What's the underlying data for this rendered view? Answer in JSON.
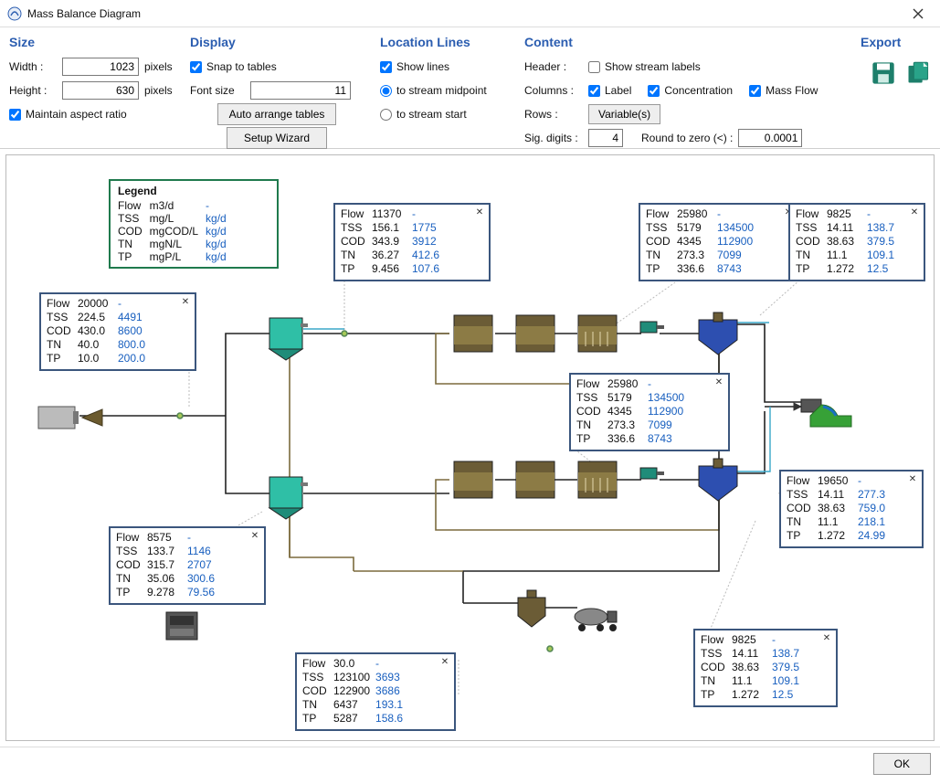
{
  "window": {
    "title": "Mass Balance Diagram"
  },
  "size": {
    "heading": "Size",
    "width_label": "Width :",
    "width_value": "1023",
    "height_label": "Height :",
    "height_value": "630",
    "units": "pixels",
    "aspect_label": "Maintain aspect ratio"
  },
  "display": {
    "heading": "Display",
    "snap_label": "Snap to tables",
    "font_label": "Font size",
    "font_value": "11",
    "auto_btn": "Auto arrange tables",
    "wizard_btn": "Setup Wizard"
  },
  "loc": {
    "heading": "Location Lines",
    "show_label": "Show lines",
    "mid_label": "to stream midpoint",
    "start_label": "to stream start"
  },
  "content": {
    "heading": "Content",
    "header_label": "Header :",
    "stream_labels": "Show stream labels",
    "columns_label": "Columns :",
    "label_chk": "Label",
    "conc_chk": "Concentration",
    "mf_chk": "Mass Flow",
    "rows_label": "Rows :",
    "var_btn": "Variable(s)",
    "sig_label": "Sig. digits :",
    "sig_value": "4",
    "round_label": "Round to zero (<) :",
    "round_value": "0.0001"
  },
  "export": {
    "heading": "Export"
  },
  "footer": {
    "ok": "OK"
  },
  "legend": {
    "title": "Legend",
    "rows": [
      {
        "label": "Flow",
        "conc_unit": "m3/d",
        "mf_unit": "-"
      },
      {
        "label": "TSS",
        "conc_unit": "mg/L",
        "mf_unit": "kg/d"
      },
      {
        "label": "COD",
        "conc_unit": "mgCOD/L",
        "mf_unit": "kg/d"
      },
      {
        "label": "TN",
        "conc_unit": "mgN/L",
        "mf_unit": "kg/d"
      },
      {
        "label": "TP",
        "conc_unit": "mgP/L",
        "mf_unit": "kg/d"
      }
    ]
  },
  "tables": {
    "t_influent": {
      "rows": [
        {
          "l": "Flow",
          "v": "20000",
          "m": "-"
        },
        {
          "l": "TSS",
          "v": "224.5",
          "m": "4491"
        },
        {
          "l": "COD",
          "v": "430.0",
          "m": "8600"
        },
        {
          "l": "TN",
          "v": "40.0",
          "m": "800.0"
        },
        {
          "l": "TP",
          "v": "10.0",
          "m": "200.0"
        }
      ]
    },
    "t_pc1": {
      "rows": [
        {
          "l": "Flow",
          "v": "11370",
          "m": "-"
        },
        {
          "l": "TSS",
          "v": "156.1",
          "m": "1775"
        },
        {
          "l": "COD",
          "v": "343.9",
          "m": "3912"
        },
        {
          "l": "TN",
          "v": "36.27",
          "m": "412.6"
        },
        {
          "l": "TP",
          "v": "9.456",
          "m": "107.6"
        }
      ]
    },
    "t_rx1": {
      "rows": [
        {
          "l": "Flow",
          "v": "25980",
          "m": "-"
        },
        {
          "l": "TSS",
          "v": "5179",
          "m": "134500"
        },
        {
          "l": "COD",
          "v": "4345",
          "m": "112900"
        },
        {
          "l": "TN",
          "v": "273.3",
          "m": "7099"
        },
        {
          "l": "TP",
          "v": "336.6",
          "m": "8743"
        }
      ]
    },
    "t_eff_top": {
      "rows": [
        {
          "l": "Flow",
          "v": "9825",
          "m": "-"
        },
        {
          "l": "TSS",
          "v": "14.11",
          "m": "138.7"
        },
        {
          "l": "COD",
          "v": "38.63",
          "m": "379.5"
        },
        {
          "l": "TN",
          "v": "11.1",
          "m": "109.1"
        },
        {
          "l": "TP",
          "v": "1.272",
          "m": "12.5"
        }
      ]
    },
    "t_rx2": {
      "rows": [
        {
          "l": "Flow",
          "v": "25980",
          "m": "-"
        },
        {
          "l": "TSS",
          "v": "5179",
          "m": "134500"
        },
        {
          "l": "COD",
          "v": "4345",
          "m": "112900"
        },
        {
          "l": "TN",
          "v": "273.3",
          "m": "7099"
        },
        {
          "l": "TP",
          "v": "336.6",
          "m": "8743"
        }
      ]
    },
    "t_pc2": {
      "rows": [
        {
          "l": "Flow",
          "v": "8575",
          "m": "-"
        },
        {
          "l": "TSS",
          "v": "133.7",
          "m": "1146"
        },
        {
          "l": "COD",
          "v": "315.7",
          "m": "2707"
        },
        {
          "l": "TN",
          "v": "35.06",
          "m": "300.6"
        },
        {
          "l": "TP",
          "v": "9.278",
          "m": "79.56"
        }
      ]
    },
    "t_comb_eff": {
      "rows": [
        {
          "l": "Flow",
          "v": "19650",
          "m": "-"
        },
        {
          "l": "TSS",
          "v": "14.11",
          "m": "277.3"
        },
        {
          "l": "COD",
          "v": "38.63",
          "m": "759.0"
        },
        {
          "l": "TN",
          "v": "11.1",
          "m": "218.1"
        },
        {
          "l": "TP",
          "v": "1.272",
          "m": "24.99"
        }
      ]
    },
    "t_eff_bot": {
      "rows": [
        {
          "l": "Flow",
          "v": "9825",
          "m": "-"
        },
        {
          "l": "TSS",
          "v": "14.11",
          "m": "138.7"
        },
        {
          "l": "COD",
          "v": "38.63",
          "m": "379.5"
        },
        {
          "l": "TN",
          "v": "11.1",
          "m": "109.1"
        },
        {
          "l": "TP",
          "v": "1.272",
          "m": "12.5"
        }
      ]
    },
    "t_sludge": {
      "rows": [
        {
          "l": "Flow",
          "v": "30.0",
          "m": "-"
        },
        {
          "l": "TSS",
          "v": "123100",
          "m": "3693"
        },
        {
          "l": "COD",
          "v": "122900",
          "m": "3686"
        },
        {
          "l": "TN",
          "v": "6437",
          "m": "193.1"
        },
        {
          "l": "TP",
          "v": "5287",
          "m": "158.6"
        }
      ]
    }
  }
}
